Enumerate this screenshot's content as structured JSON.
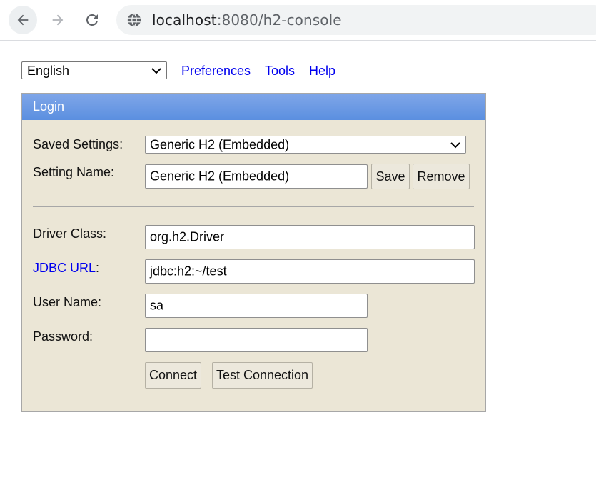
{
  "browser": {
    "url_host": "localhost",
    "url_rest": ":8080/h2-console",
    "icons": {
      "back": "back-arrow-icon",
      "forward": "forward-arrow-icon",
      "reload": "reload-icon",
      "site": "globe-icon"
    }
  },
  "topnav": {
    "language": "English",
    "links": [
      "Preferences",
      "Tools",
      "Help"
    ]
  },
  "login": {
    "title": "Login",
    "saved_settings_label": "Saved Settings:",
    "saved_settings_value": "Generic H2 (Embedded)",
    "setting_name_label": "Setting Name:",
    "setting_name_value": "Generic H2 (Embedded)",
    "save_label": "Save",
    "remove_label": "Remove",
    "driver_class_label": "Driver Class:",
    "driver_class_value": "org.h2.Driver",
    "jdbc_url_link": "JDBC URL",
    "jdbc_url_colon": ":",
    "jdbc_url_value": "jdbc:h2:~/test",
    "user_name_label": "User Name:",
    "user_name_value": "sa",
    "password_label": "Password:",
    "password_value": "",
    "connect_label": "Connect",
    "test_connection_label": "Test Connection"
  },
  "colors": {
    "panel_bg": "#ebe6d6",
    "header_gradient_top": "#7fa6e8",
    "header_gradient_bottom": "#5b8fe0",
    "link": "#0000ee"
  }
}
